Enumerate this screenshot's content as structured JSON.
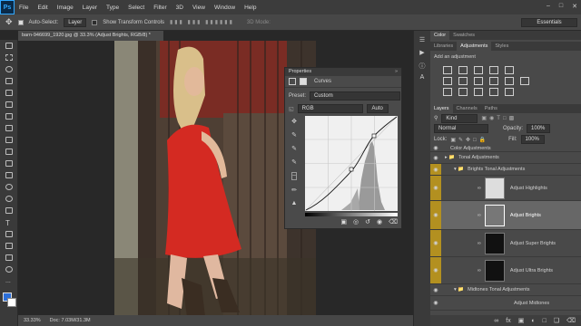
{
  "app": {
    "logo": "Ps"
  },
  "menu": [
    "File",
    "Edit",
    "Image",
    "Layer",
    "Type",
    "Select",
    "Filter",
    "3D",
    "View",
    "Window",
    "Help"
  ],
  "options": {
    "auto_select": "Auto-Select:",
    "target": "Layer",
    "transform": "Show Transform Controls",
    "mode3d": "3D Mode:",
    "workspace": "Essentials"
  },
  "document": {
    "tab": "barn-946699_1920.jpg @ 33.3% (Adjust Brights, RGB/8) *",
    "zoom": "33.33%",
    "doc": "Doc: 7.03M/31.3M"
  },
  "properties": {
    "title": "Properties",
    "panel": "Curves",
    "preset_label": "Preset:",
    "preset_value": "Custom",
    "channel": "RGB",
    "auto": "Auto"
  },
  "right": {
    "top_tabs": [
      "Color",
      "Swatches"
    ],
    "mid_tabs": [
      "Libraries",
      "Adjustments",
      "Styles"
    ],
    "add_adjustment": "Add an adjustment",
    "layer_tabs": [
      "Layers",
      "Channels",
      "Paths"
    ],
    "kind": "Kind",
    "blend": "Normal",
    "opacity_label": "Opacity:",
    "opacity": "100%",
    "lock_label": "Lock:",
    "fill_label": "Fill:",
    "fill": "100%",
    "layers": [
      {
        "name": "Color Adjustments",
        "type": "group"
      },
      {
        "name": "Tonal Adjustments",
        "type": "group"
      },
      {
        "name": "Brights Tonal Adjustments",
        "type": "group"
      },
      {
        "name": "Adjust Highlights",
        "type": "layer"
      },
      {
        "name": "Adjust Brights",
        "type": "layer"
      },
      {
        "name": "Adjust Super Brights",
        "type": "layer"
      },
      {
        "name": "Adjust Ultra Brights",
        "type": "layer"
      },
      {
        "name": "Midtones Tonal Adjustments",
        "type": "group"
      },
      {
        "name": "Adjust Midtones",
        "type": "layer"
      }
    ]
  },
  "colors": {
    "accent_yellow": "#b39020",
    "selection": "#676767",
    "ps_blue": "#31a8ff"
  },
  "icons": [
    "move-icon",
    "marquee-icon",
    "lasso-icon",
    "magic-wand-icon",
    "crop-icon",
    "eyedropper-icon",
    "heal-icon",
    "brush-icon",
    "stamp-icon",
    "history-brush-icon",
    "eraser-icon",
    "gradient-icon",
    "blur-icon",
    "dodge-icon",
    "pen-icon",
    "type-icon",
    "path-select-icon",
    "shape-icon",
    "hand-icon",
    "zoom-icon"
  ]
}
